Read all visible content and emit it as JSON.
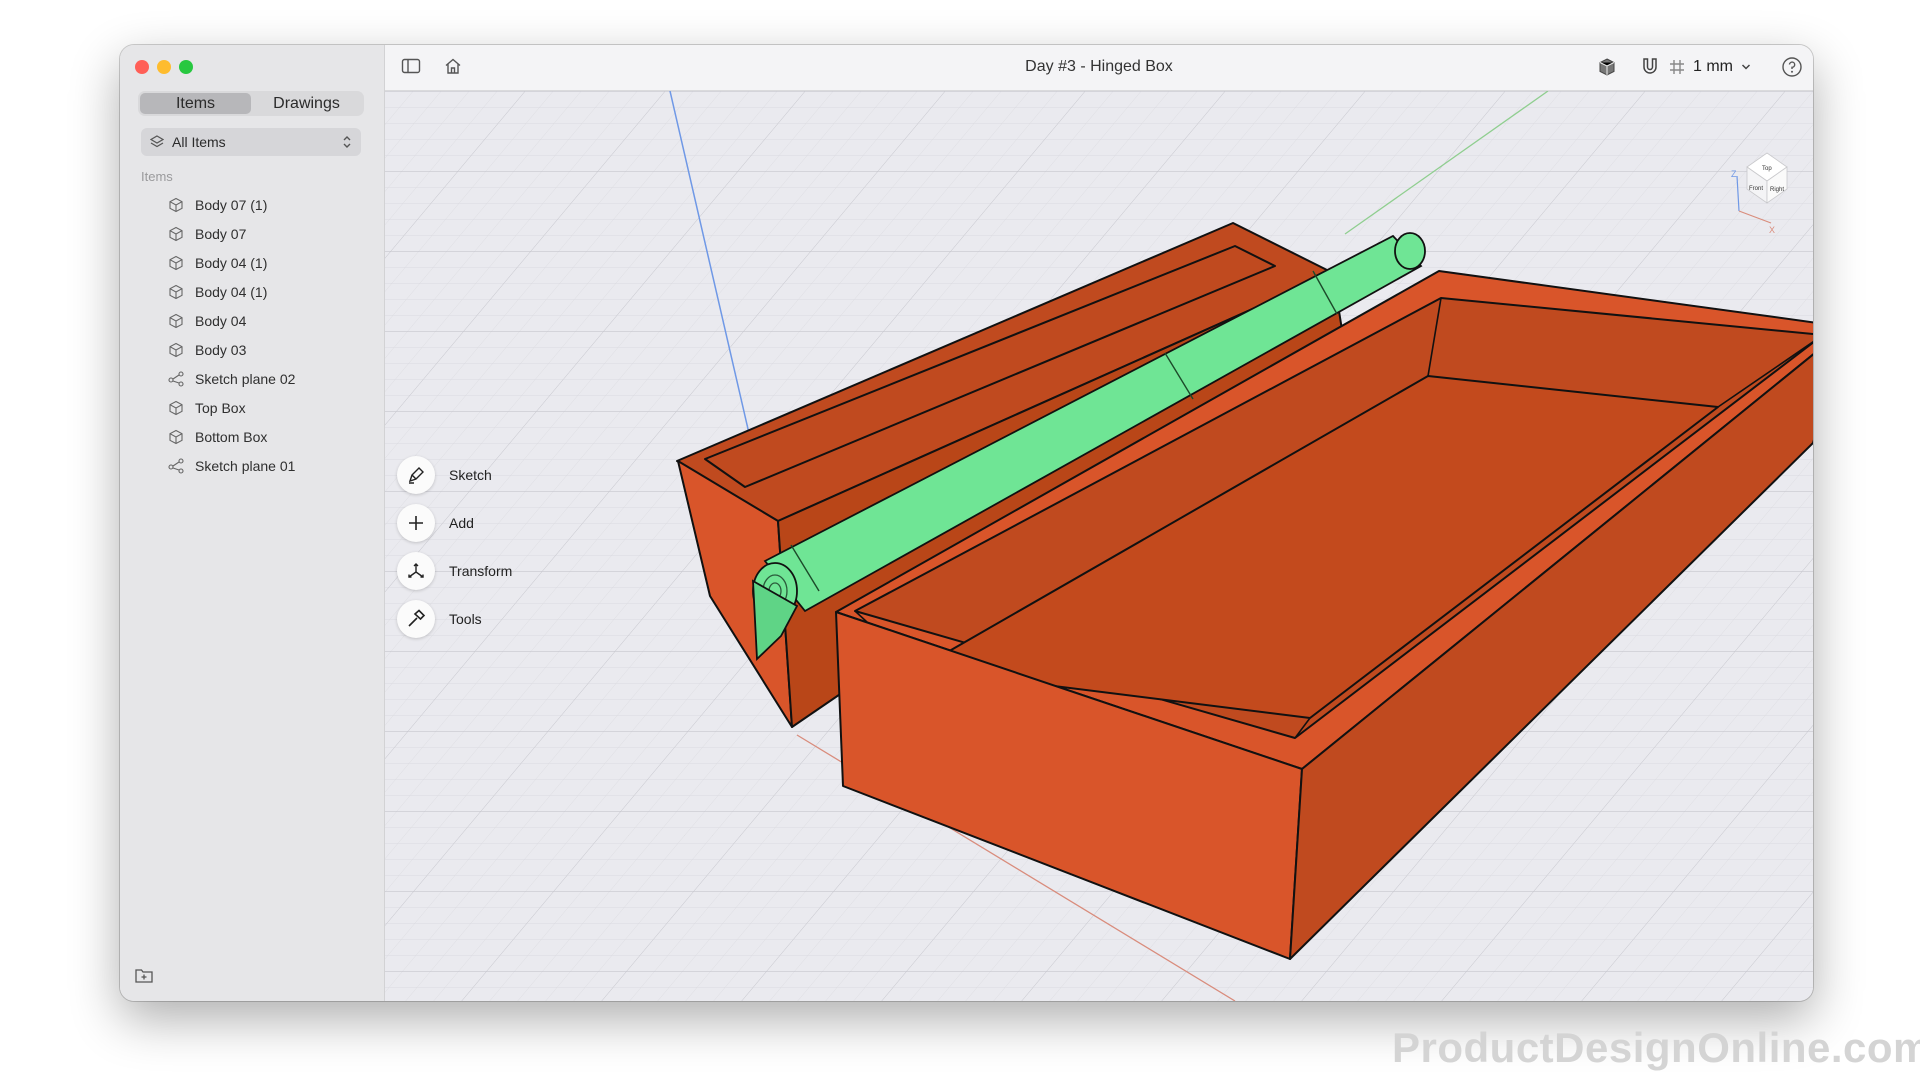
{
  "window": {
    "title": "Day #3 - Hinged Box"
  },
  "sidebar": {
    "tabs": [
      {
        "label": "Items",
        "active": true
      },
      {
        "label": "Drawings",
        "active": false
      }
    ],
    "filter": {
      "label": "All Items"
    },
    "section_label": "Items",
    "items": [
      {
        "label": "Body 07 (1)",
        "icon": "cube-icon"
      },
      {
        "label": "Body 07",
        "icon": "cube-icon"
      },
      {
        "label": "Body 04 (1)",
        "icon": "cube-icon"
      },
      {
        "label": "Body 04 (1)",
        "icon": "cube-icon"
      },
      {
        "label": "Body 04",
        "icon": "cube-icon"
      },
      {
        "label": "Body 03",
        "icon": "cube-icon"
      },
      {
        "label": "Sketch plane 02",
        "icon": "sketch-plane-icon"
      },
      {
        "label": "Top Box",
        "icon": "cube-icon"
      },
      {
        "label": "Bottom Box",
        "icon": "cube-icon"
      },
      {
        "label": "Sketch plane 01",
        "icon": "sketch-plane-icon"
      }
    ]
  },
  "toolbar": {
    "grid_unit": "1 mm"
  },
  "tools": [
    {
      "label": "Sketch",
      "icon": "pen-icon"
    },
    {
      "label": "Add",
      "icon": "plus-icon"
    },
    {
      "label": "Transform",
      "icon": "transform-icon"
    },
    {
      "label": "Tools",
      "icon": "hammer-icon"
    }
  ],
  "viewcube": {
    "faces": [
      "Top",
      "Front",
      "Right"
    ],
    "axes": [
      "Z",
      "X"
    ]
  },
  "colors": {
    "box": "#d9552a",
    "hinge": "#6fe595",
    "accent_close": "#ff5f57",
    "accent_min": "#febc2e",
    "accent_max": "#28c840"
  },
  "watermark": "ProductDesignOnline.com"
}
